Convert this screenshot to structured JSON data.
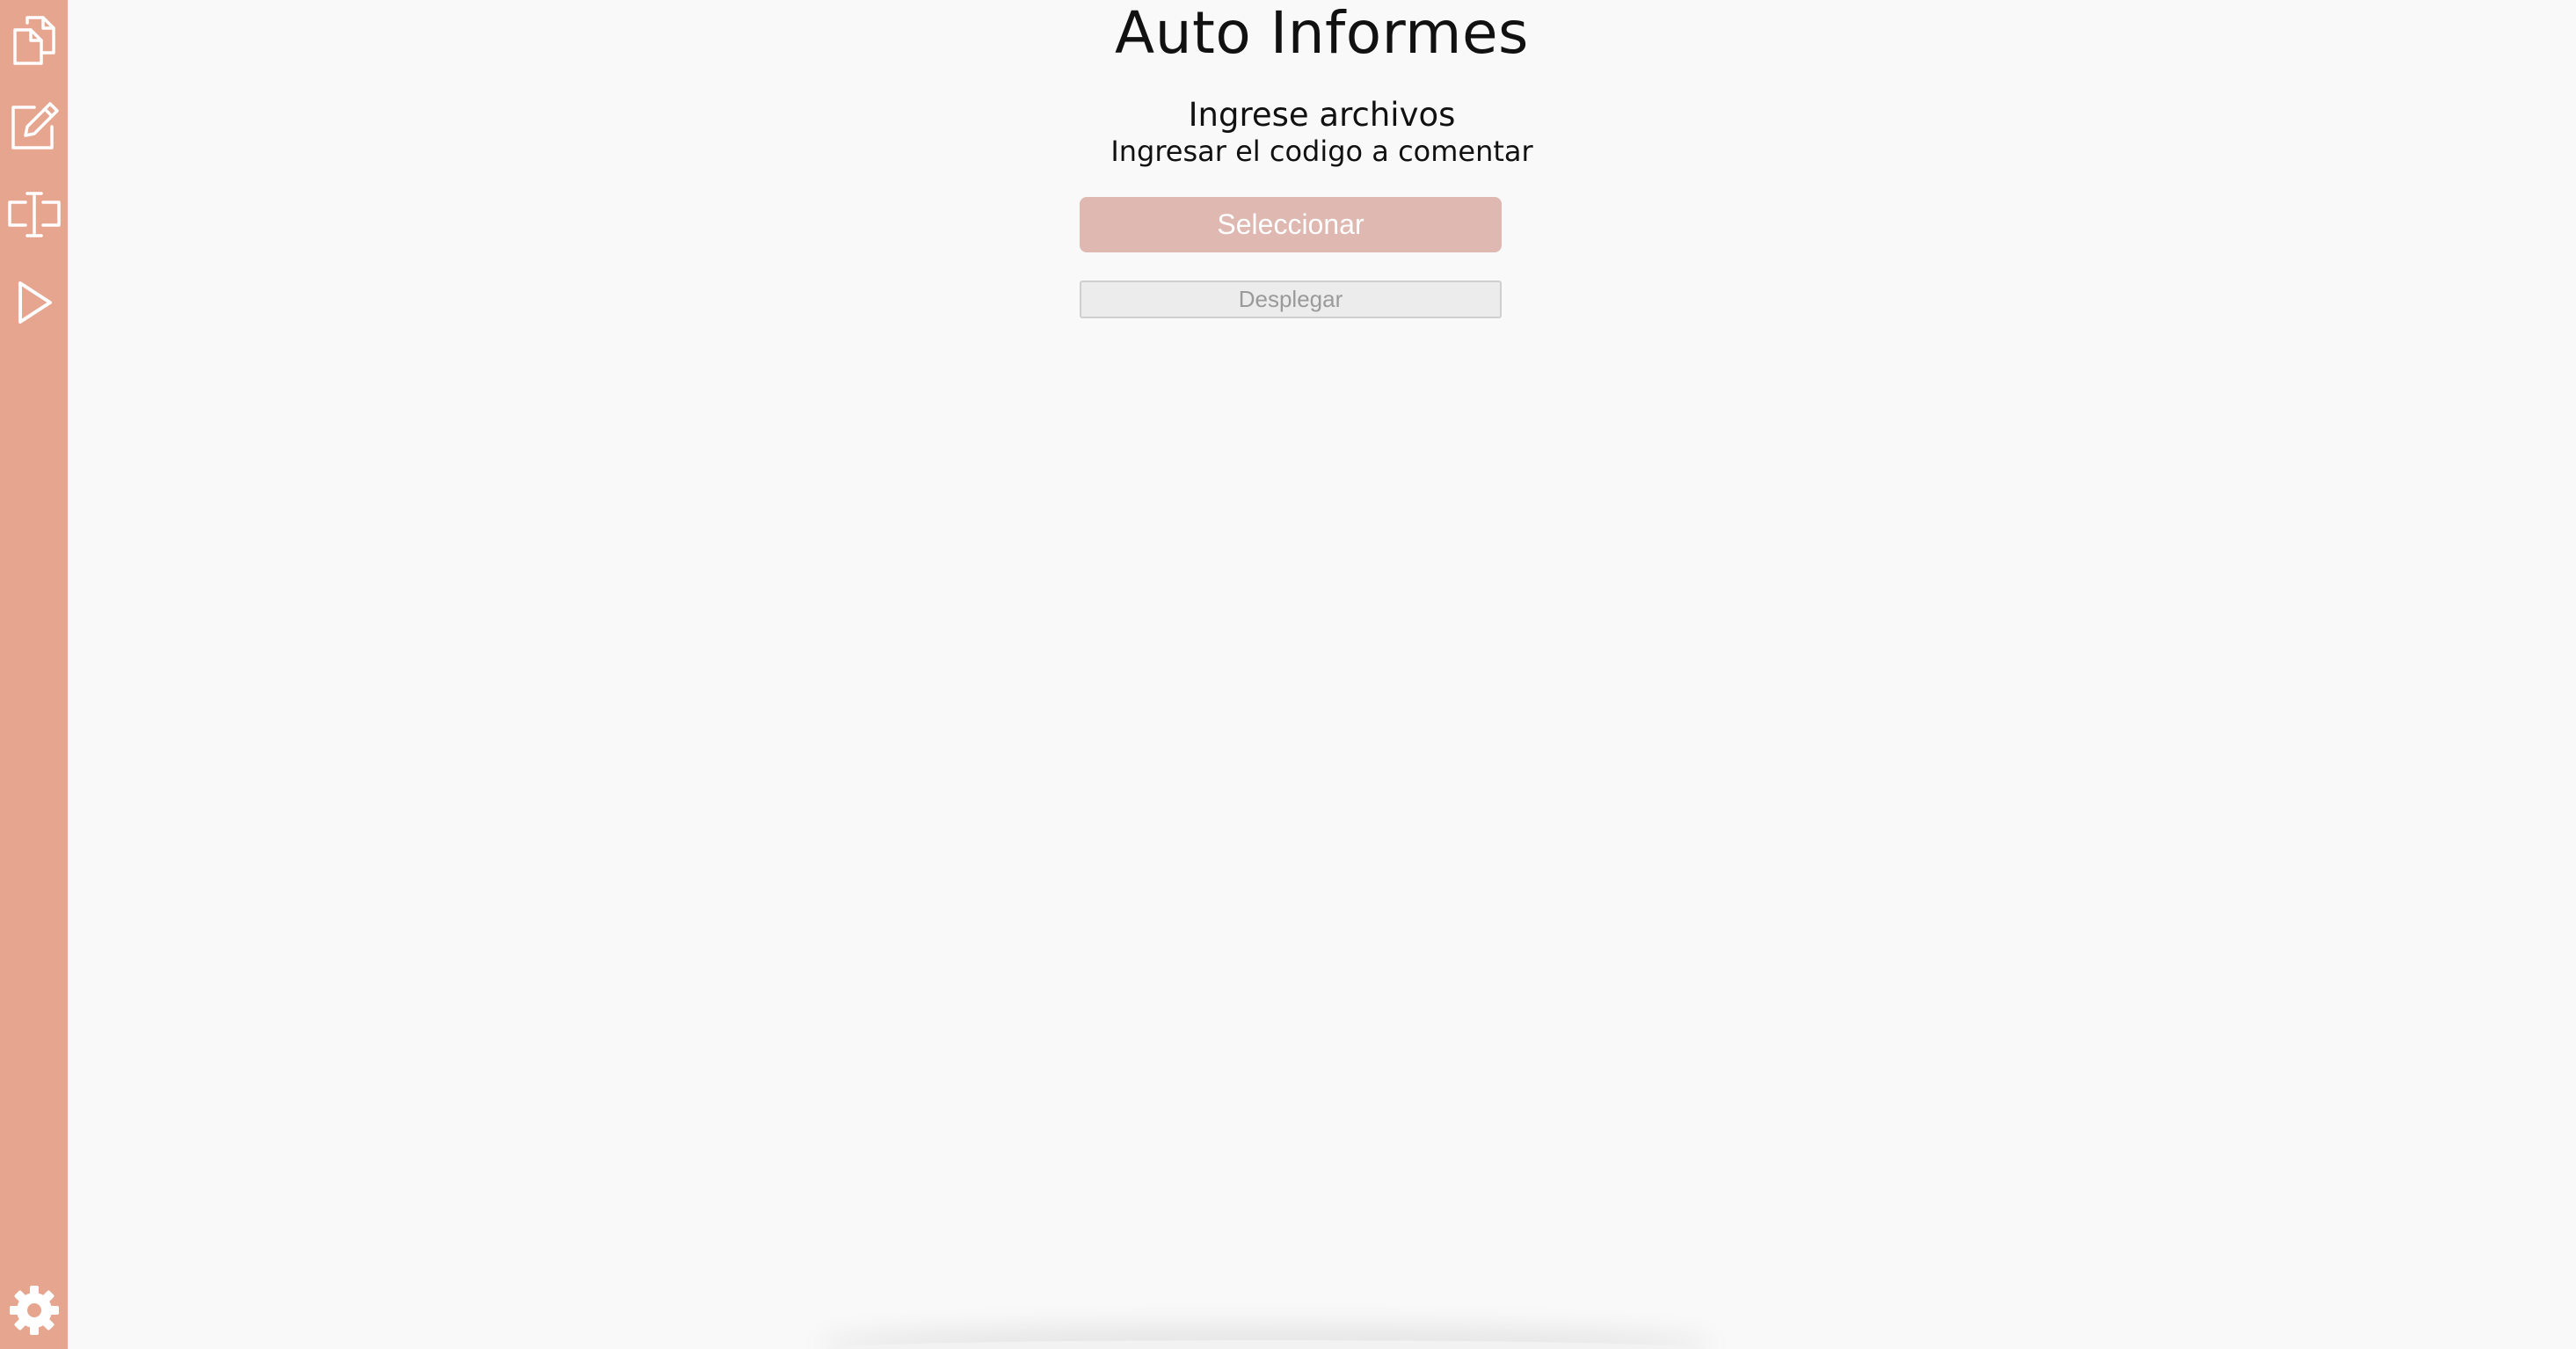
{
  "app": {
    "title": "Auto Informes"
  },
  "sidebar": {
    "background_color": "#e6a58f",
    "items": [
      {
        "icon": "files-icon"
      },
      {
        "icon": "edit-icon"
      },
      {
        "icon": "text-cursor-icon"
      },
      {
        "icon": "play-icon"
      }
    ],
    "footer_icon": "gear-icon"
  },
  "main": {
    "subtitle": "Ingrese archivos",
    "description": "Ingresar el codigo a comentar",
    "select_button": {
      "label": "Seleccionar",
      "color": "#deb8b1"
    },
    "deploy_button": {
      "label": "Desplegar"
    }
  }
}
